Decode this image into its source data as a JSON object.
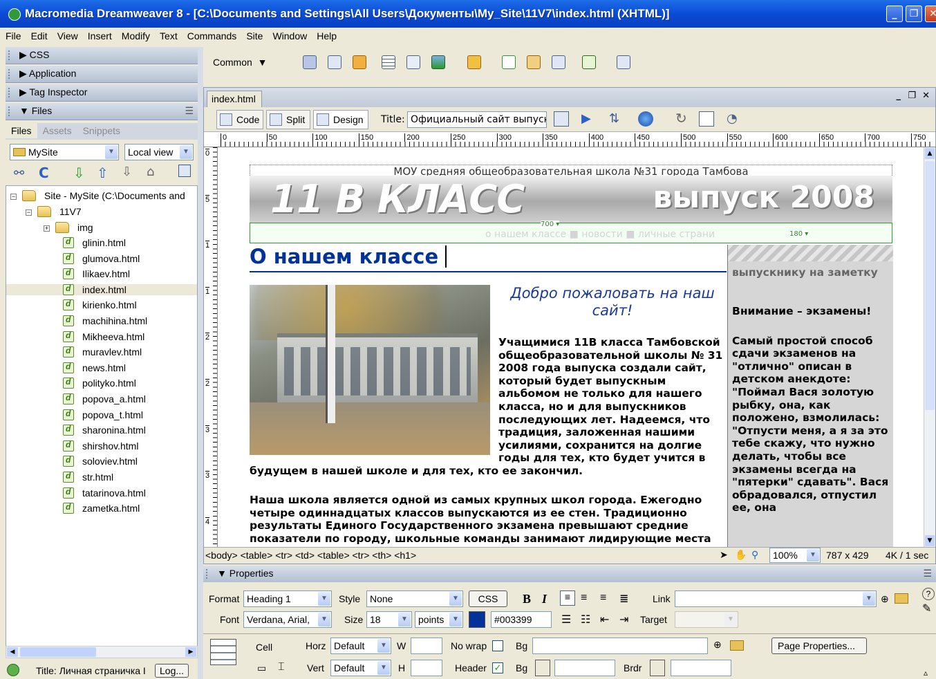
{
  "window": {
    "title": "Macromedia Dreamweaver 8 - [C:\\Documents and Settings\\All Users\\Документы\\My_Site\\11V7\\index.html (XHTML)]"
  },
  "menu": [
    "File",
    "Edit",
    "View",
    "Insert",
    "Modify",
    "Text",
    "Commands",
    "Site",
    "Window",
    "Help"
  ],
  "panels": {
    "css": "CSS",
    "application": "Application",
    "tag_inspector": "Tag Inspector",
    "files": "Files"
  },
  "files_panel": {
    "tabs": [
      "Files",
      "Assets",
      "Snippets"
    ],
    "site_select": "MySite",
    "view_select": "Local view",
    "root": "Site - MySite (C:\\Documents and",
    "folder": "11V7",
    "subfolder": "img",
    "files": [
      "glinin.html",
      "glumova.html",
      "Ilikaev.html",
      "index.html",
      "kirienko.html",
      "machihina.html",
      "Mikheeva.html",
      "muravlev.html",
      "news.html",
      "polityko.html",
      "popova_a.html",
      "popova_t.html",
      "sharonina.html",
      "shirshov.html",
      "soloviev.html",
      "str.html",
      "tatarinova.html",
      "zametka.html"
    ],
    "selected_file": "index.html",
    "status_title": "Title: Личная страничка I",
    "log_button": "Log..."
  },
  "insert_bar": {
    "category": "Common"
  },
  "document": {
    "tab": "index.html",
    "views": [
      "Code",
      "Split",
      "Design"
    ],
    "active_view": "Design",
    "title_label": "Title:",
    "title_value": "Официальный сайт выпускн",
    "ruler_h": [
      "0",
      "50",
      "100",
      "150",
      "200",
      "250",
      "300",
      "350",
      "400",
      "450",
      "500",
      "550",
      "600",
      "650",
      "700",
      "750"
    ],
    "ruler_v": [
      "0",
      "5",
      "1",
      "1",
      "2",
      "2",
      "3",
      "3",
      "4"
    ],
    "status_path": "<body> <table> <tr> <td> <table> <tr> <th> <h1>",
    "zoom": "100%",
    "size": "787 x 429",
    "download": "4K / 1 sec"
  },
  "page": {
    "header": "МОУ средняя общеобразовательная школа №31 города Тамбова",
    "banner_left": "11 В КЛАСС",
    "banner_right": "выпуск 2008",
    "nav_text": "о нашем классе ■ новости ■ личные страни",
    "width_700": "700",
    "width_180": "180",
    "heading": "О нашем классе",
    "welcome": "Добро пожаловать на наш сайт!",
    "intro": "Учащимися 11В класса Тамбовской общеобразовательной школы № 31 2008 года выпуска создали сайт, который будет выпускным альбомом не только для нашего класса, но и для выпускников последующих лет. Надеемся, что традиция, заложенная нашими усилиями, сохранится на долгие годы для тех, кто будет учится в будущем в нашей школе и для тех, кто ее закончил.",
    "para2": "Наша школа является одной из самых крупных школ города. Ежегодно четыре одиннадцатых классов выпускаются из ее стен. Традиционно результаты Единого Государственного экзамена превышают средние показатели по городу, школьные команды занимают лидирующие места",
    "side_title": "выпускнику на заметку",
    "side_exam": "Внимание – экзамены!",
    "side_text": "Самый простой способ сдачи экзаменов на \"отлично\" описан в детском анекдоте: \"Поймал Вася золотую рыбку, она, как положено, взмолилась: \"Отпусти меня, а я за это тебе скажу, что нужно делать, чтобы все экзамены всегда на \"пятерки\" сдавать\". Вася обрадовался, отпустил ее, она"
  },
  "properties": {
    "panel_title": "Properties",
    "format_label": "Format",
    "format_value": "Heading 1",
    "style_label": "Style",
    "style_value": "None",
    "css_button": "CSS",
    "link_label": "Link",
    "font_label": "Font",
    "font_value": "Verdana, Arial,",
    "size_label": "Size",
    "size_value": "18",
    "unit_value": "points",
    "color_value": "#003399",
    "target_label": "Target",
    "cell_label": "Cell",
    "horz_label": "Horz",
    "horz_value": "Default",
    "vert_label": "Vert",
    "vert_value": "Default",
    "w_label": "W",
    "h_label": "H",
    "nowrap_label": "No wrap",
    "header_label": "Header",
    "bg_label": "Bg",
    "brdr_label": "Brdr",
    "page_props_button": "Page Properties..."
  },
  "colors": {
    "heading": "#003399",
    "titlebar": "#0a4bd6"
  }
}
